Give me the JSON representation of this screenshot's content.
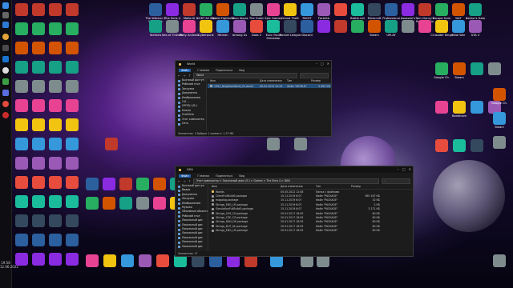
{
  "taskbar": {
    "clock_time": "19:58",
    "clock_date": "12.06.2022"
  },
  "window1": {
    "title": "World",
    "ribbon": [
      "Файл",
      "Главная",
      "Поделиться",
      "Вид"
    ],
    "address": "World",
    "nav": [
      "Быстрый доступ",
      "Рабочий стол",
      "Загрузки",
      "Документы",
      "Изображения",
      "2.6 ...",
      "OFFSILI (D:)",
      "Клипы",
      "",
      "OneDrive",
      "",
      "Этот компьютер",
      "",
      "Сеть"
    ],
    "columns": [
      "Имя",
      "Дата изменения",
      "Тип",
      "Размер"
    ],
    "rows": [
      {
        "name": "1994_NeighborWorld_01.world",
        "date": "06.02.2022 22:29",
        "type": "Файл \"WORLD\"",
        "size": "9 867 КБ"
      }
    ],
    "status": "Элементов: 1   Выбран 1 элемент: 1,37 МБ"
  },
  "window2": {
    "title": "DKN",
    "ribbon": [
      "Файл",
      "Главная",
      "Поделиться",
      "Вид"
    ],
    "address": "Этот компьютер  >  Локальный диск (E:)  >  Games  >  The Sims 4  >  DKN",
    "nav": [
      "Быстрый доступ",
      "Видео",
      "Документы",
      "Загрузки",
      "Изображения",
      "Музыка",
      "Объемные объекты",
      "Рабочий стол",
      "Локальный дис",
      "Локальный дис",
      "Локальный дис",
      "Локальный дис",
      "Локальный дис",
      "Локальный дис",
      "Локальный дис"
    ],
    "columns": [
      "Имя",
      "Дата изменения",
      "Тип",
      "Размер"
    ],
    "rows": [
      {
        "name": "Worlds",
        "date": "05.05.2022 12:08",
        "type": "Папка с файлами",
        "size": ""
      },
      {
        "name": "ClientFullBuild0.package",
        "date": "15.11.2019 6:07",
        "type": "Файл \"PACKAGE\"",
        "size": "365 167 КБ"
      },
      {
        "name": "magalog.package",
        "date": "15.11.2019 6:07",
        "type": "Файл \"PACKAGE\"",
        "size": "32 КБ"
      },
      {
        "name": "Strings_ENG_US.package",
        "date": "15.11.2019 6:07",
        "type": "Файл \"PACKAGE\"",
        "size": "2 КБ"
      },
      {
        "name": "SimulationFullBuild0.package",
        "date": "15.11.2019 6:07",
        "type": "Файл \"PACKAGE\"",
        "size": "3 171 КБ"
      },
      {
        "name": "Strings_CHS_CN.package",
        "date": "20.01.2017 18:05",
        "type": "Файл \"PACKAGE\"",
        "size": "60 КБ"
      },
      {
        "name": "Strings_CZE_CZ.package",
        "date": "20.01.2017 18:05",
        "type": "Файл \"PACKAGE\"",
        "size": "60 КБ"
      },
      {
        "name": "Strings_DAN_DK.package",
        "date": "20.01.2017 18:05",
        "type": "Файл \"PACKAGE\"",
        "size": "60 КБ"
      },
      {
        "name": "Strings_DUT_NL.package",
        "date": "20.01.2017 18:05",
        "type": "Файл \"PACKAGE\"",
        "size": "60 КБ"
      },
      {
        "name": "Strings_ENG_US.package",
        "date": "20.01.2017 18:05",
        "type": "Файл \"PACKAGE\"",
        "size": "60 КБ"
      }
    ],
    "status": "Элементов: 17"
  },
  "desktop": {
    "icons_top_row": [
      "The Witcher 3 Wild Hunt",
      "The Sims 4",
      "Mafia III",
      "NICKT All Star Brawl",
      "Street Fighter V",
      "Neon Abyss",
      "The Outer Worlds",
      "Epic Games Launcher",
      "Grand Theft Auto",
      "PACKT",
      "Fortnite",
      "",
      "Battle.net",
      "Minecraft",
      "Professional",
      "Assassin's Creed",
      "Tom Clancy's Rainbow Six",
      "Escape from Tarkov",
      "WoT",
      "Baldur's Gate"
    ],
    "icons_second_row": [
      "Stellaris",
      "Sea of Thieves",
      "Party Animals",
      "Cyberpunk",
      "Hitman",
      "Among Us",
      "Dota 2",
      "Euro Truck Simulator",
      "Rocket League",
      "Discord",
      "",
      "",
      "",
      "Steam",
      "UPLAY",
      "",
      "",
      "Crusader Kings",
      "Total War",
      "GTA V"
    ],
    "icons_left_columns": [
      "",
      "",
      "",
      "",
      "",
      "",
      "",
      "",
      "",
      "",
      "",
      "",
      "",
      ""
    ],
    "icons_bottom_row": [
      "",
      "",
      "",
      "",
      "",
      "",
      "",
      "",
      "",
      ""
    ],
    "icons_right": [
      "Google Ch.",
      "Steam",
      "",
      "",
      "",
      "Bandicam",
      "",
      "",
      "",
      "",
      ""
    ]
  },
  "colors": {
    "accent": "#1f5fa8",
    "selection": "#264f78",
    "window_bg": "#1c1c1c",
    "folder": "#e8c15a"
  }
}
